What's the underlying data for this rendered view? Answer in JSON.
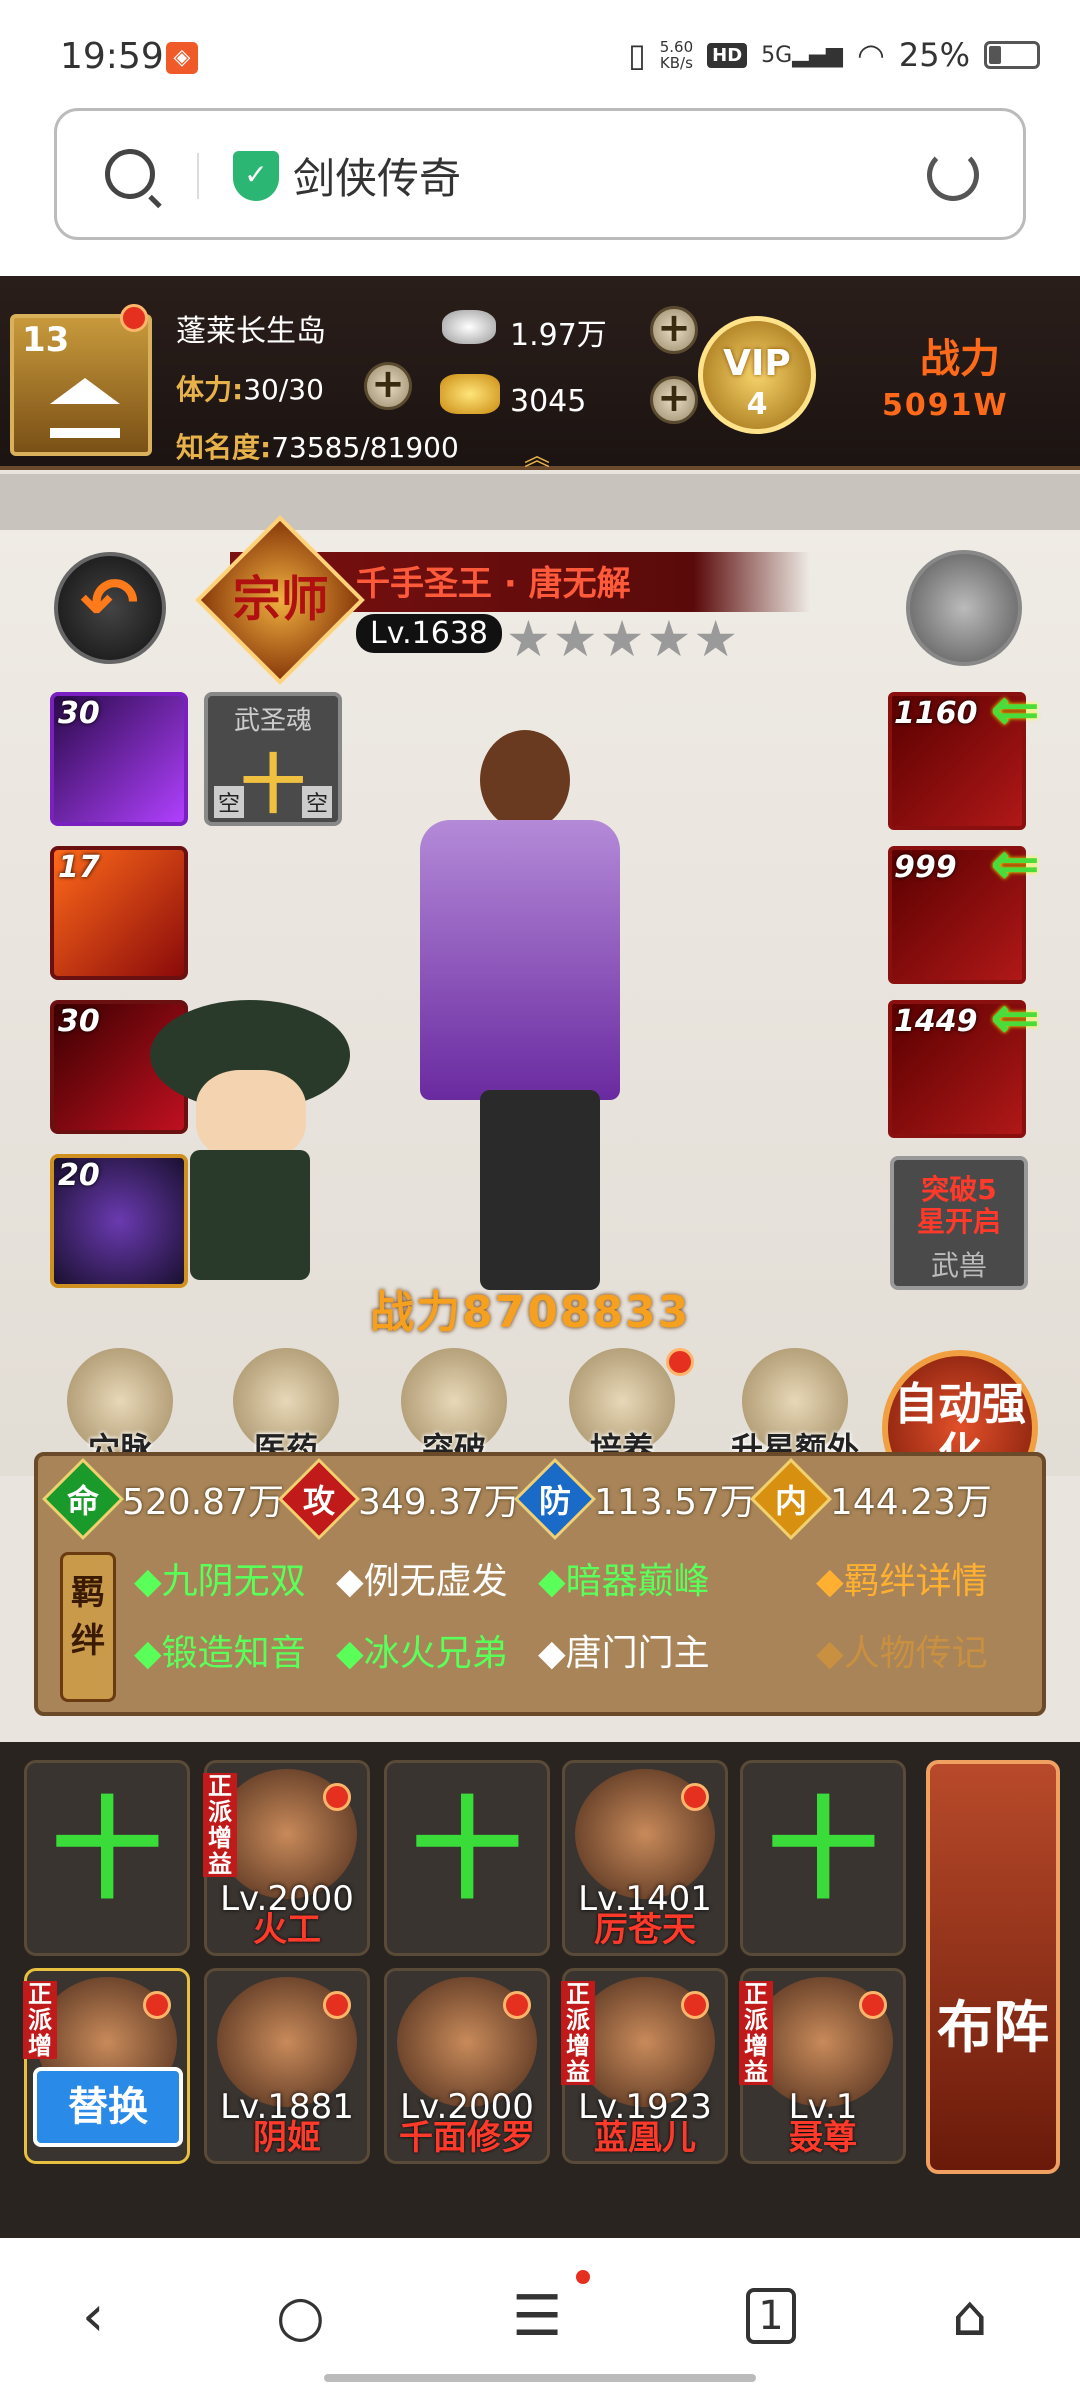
{
  "status": {
    "time": "19:59",
    "speed_top": "5.60",
    "speed_bottom": "KB/s",
    "hd": "HD",
    "net": "5G",
    "battery": "25%"
  },
  "browser": {
    "title": "剑侠传奇"
  },
  "game": {
    "player": {
      "level": "13",
      "name": "蓬莱长生岛",
      "stamina_label": "体力:",
      "stamina": "30/30",
      "fame_label": "知名度:",
      "fame": "73585/81900"
    },
    "silver": "1.97万",
    "gold": "3045",
    "vip": {
      "label": "VIP",
      "level": "4"
    },
    "power_label": "战力",
    "power_value": "5091W",
    "hero": {
      "title_emblem": "宗师",
      "name": "千手圣王 · 唐无解",
      "level": "Lv.1638",
      "stars": "★★★★★",
      "strength": "战力8708833"
    },
    "skills": [
      {
        "level": "30"
      },
      {
        "level": "17"
      },
      {
        "level": "30"
      },
      {
        "level": "20"
      }
    ],
    "soul": {
      "label": "武圣魂",
      "plus": "十",
      "empty1": "空",
      "empty2": "空"
    },
    "equips": [
      {
        "level": "1160"
      },
      {
        "level": "999"
      },
      {
        "level": "1449"
      }
    ],
    "breakthrough": {
      "line1": "突破5",
      "line2": "星开启",
      "line3": "武兽"
    },
    "menu": [
      {
        "label": "穴脉"
      },
      {
        "label": "医药"
      },
      {
        "label": "突破"
      },
      {
        "label": "培养"
      },
      {
        "label": "升星额外"
      }
    ],
    "auto_enhance": "自动强化",
    "stats": [
      {
        "badge": "命",
        "value": "520.87万",
        "color": "#1a9a2a"
      },
      {
        "badge": "攻",
        "value": "349.37万",
        "color": "#c01a1a"
      },
      {
        "badge": "防",
        "value": "113.57万",
        "color": "#1a6ac8"
      },
      {
        "badge": "内",
        "value": "144.23万",
        "color": "#d89010"
      }
    ],
    "bond_label": "羁绊",
    "bonds": [
      "◆九阴无双",
      "◆例无虚发",
      "◆暗器巅峰",
      "◆锻造知音",
      "◆冰火兄弟",
      "◆唐门门主"
    ],
    "bond_detail": "◆羁绊详情",
    "biography": "◆人物传记",
    "lineup": {
      "top": [
        {
          "type": "empty",
          "plus": "十"
        },
        {
          "type": "hero",
          "tag": "正派增益",
          "level": "Lv.2000",
          "name": "火工"
        },
        {
          "type": "empty",
          "plus": "十"
        },
        {
          "type": "hero",
          "tag": "",
          "level": "Lv.1401",
          "name": "厉苍天"
        },
        {
          "type": "empty",
          "plus": "十"
        }
      ],
      "bottom": [
        {
          "tag": "正派增",
          "swap": "替换"
        },
        {
          "tag": "",
          "level": "Lv.1881",
          "name": "阴姬"
        },
        {
          "tag": "",
          "level": "Lv.2000",
          "name": "千面修罗"
        },
        {
          "tag": "正派增益",
          "level": "Lv.1923",
          "name": "蓝凰儿"
        },
        {
          "tag": "正派增益",
          "level": "Lv.1",
          "name": "聂尊"
        }
      ],
      "formation": "布阵"
    }
  },
  "nav": {
    "back": "‹",
    "search": "○",
    "menu": "☰",
    "tabs": "1",
    "home": "⌂"
  }
}
